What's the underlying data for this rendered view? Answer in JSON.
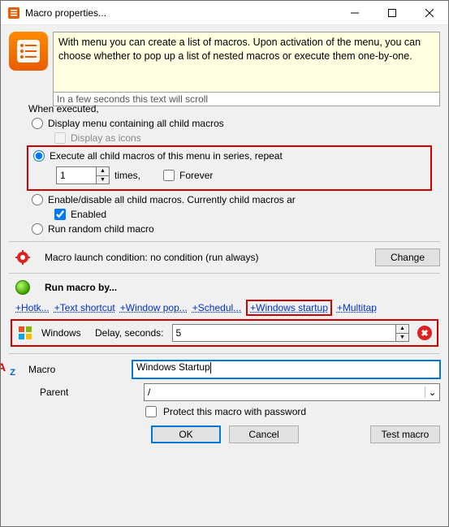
{
  "window": {
    "title": "Macro properties..."
  },
  "info": {
    "text": "With menu you can create a list of macros. Upon activation of the menu, you can choose whether to pop up a list of nested macros or execute them one-by-one.",
    "scroll_note": "In a few seconds this text will scroll"
  },
  "when_executed_label": "When executed,",
  "options": {
    "display_menu": {
      "label": "Display menu containing all child macros",
      "selected": false
    },
    "display_icons": {
      "label": "Display as icons",
      "checked": false
    },
    "execute_series": {
      "label": "Execute all child macros of this menu in series, repeat",
      "selected": true,
      "times_value": "1",
      "times_suffix": "times,",
      "forever_label": "Forever",
      "forever_checked": false
    },
    "enable_disable": {
      "label": "Enable/disable all child macros. Currently child macros ar",
      "selected": false
    },
    "enabled": {
      "label": "Enabled",
      "checked": true
    },
    "run_random": {
      "label": "Run random child macro",
      "selected": false
    }
  },
  "launch": {
    "text": "Macro launch condition: no condition (run always)",
    "change_btn": "Change"
  },
  "run_by_label": "Run macro by...",
  "triggers": {
    "hotkey": "+Hotk...",
    "text_shortcut": "+Text shortcut",
    "window_popup": "+Window pop...",
    "schedule": "+Schedul...",
    "windows_startup": "+Windows startup",
    "multitap": "+Multitap"
  },
  "startup": {
    "label": "Windows",
    "delay_label": "Delay, seconds:",
    "delay_value": "5"
  },
  "macro": {
    "label": "Macro",
    "value": "Windows Startup",
    "parent_label": "Parent",
    "parent_value": "/",
    "protect_label": "Protect this macro with password",
    "protect_checked": false
  },
  "buttons": {
    "ok": "OK",
    "cancel": "Cancel",
    "test": "Test macro"
  }
}
